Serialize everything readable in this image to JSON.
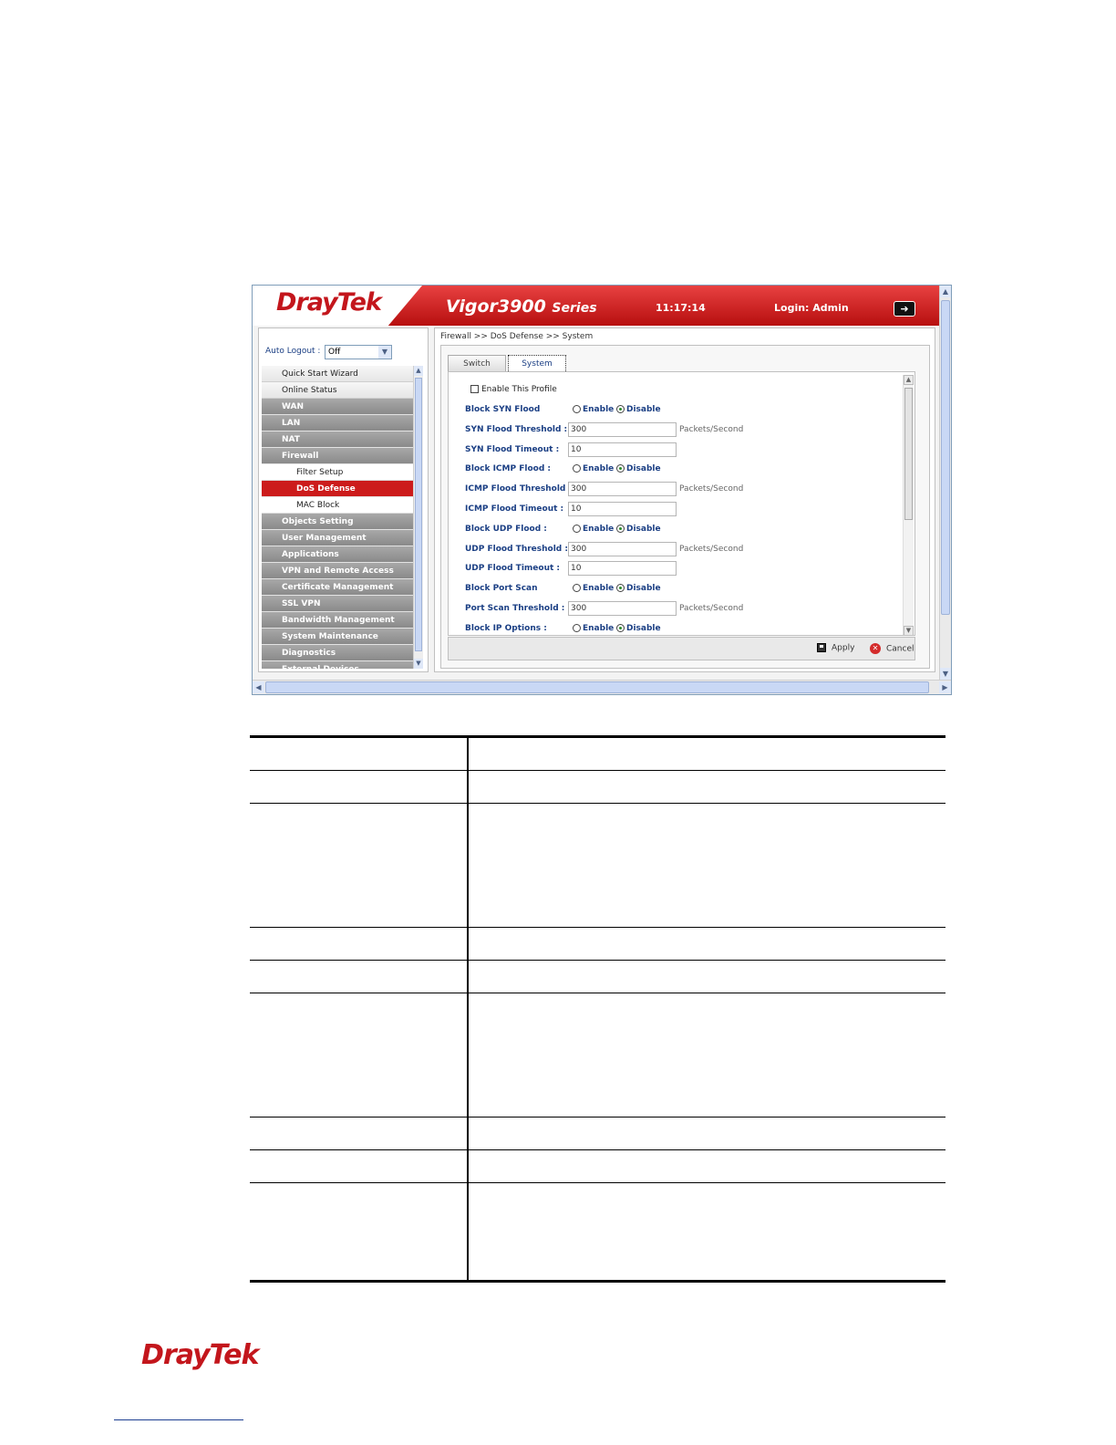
{
  "header": {
    "brand": "DrayTek",
    "model": "Vigor3900",
    "series": "Series",
    "time": "11:17:14",
    "login": "Login: Admin"
  },
  "left_panel": {
    "auto_logout_label": "Auto Logout :",
    "auto_logout_value": "Off",
    "menu": [
      {
        "label": "Quick Start Wizard",
        "style": "light"
      },
      {
        "label": "Online Status",
        "style": "light"
      },
      {
        "label": "WAN",
        "style": "dark"
      },
      {
        "label": "LAN",
        "style": "dark"
      },
      {
        "label": "NAT",
        "style": "dark"
      },
      {
        "label": "Firewall",
        "style": "dark"
      },
      {
        "label": "Filter Setup",
        "style": "sub"
      },
      {
        "label": "DoS Defense",
        "style": "active"
      },
      {
        "label": "MAC Block",
        "style": "sub"
      },
      {
        "label": "Objects Setting",
        "style": "dark"
      },
      {
        "label": "User Management",
        "style": "dark"
      },
      {
        "label": "Applications",
        "style": "dark"
      },
      {
        "label": "VPN and Remote Access",
        "style": "dark"
      },
      {
        "label": "Certificate Management",
        "style": "dark"
      },
      {
        "label": "SSL VPN",
        "style": "dark"
      },
      {
        "label": "Bandwidth Management",
        "style": "dark"
      },
      {
        "label": "System Maintenance",
        "style": "dark"
      },
      {
        "label": "Diagnostics",
        "style": "dark"
      },
      {
        "label": "External Devices",
        "style": "dark"
      }
    ]
  },
  "content": {
    "breadcrumb": "Firewall >> DoS Defense >> System",
    "tabs": [
      {
        "label": "Switch",
        "selected": false
      },
      {
        "label": "System",
        "selected": true
      }
    ],
    "enable_profile_label": "Enable This Profile",
    "enable_label": "Enable",
    "disable_label": "Disable",
    "unit_label": "Packets/Second",
    "rows": [
      {
        "type": "radio",
        "label": "Block SYN Flood",
        "value": "Disable"
      },
      {
        "type": "text",
        "label": "SYN Flood Threshold :",
        "value": "300",
        "unit": true
      },
      {
        "type": "text",
        "label": "SYN Flood Timeout :",
        "value": "10",
        "unit": false
      },
      {
        "type": "radio",
        "label": "Block ICMP Flood :",
        "value": "Disable"
      },
      {
        "type": "text",
        "label": "ICMP Flood Threshold :",
        "value": "300",
        "unit": true
      },
      {
        "type": "text",
        "label": "ICMP Flood Timeout :",
        "value": "10",
        "unit": false
      },
      {
        "type": "radio",
        "label": "Block UDP Flood :",
        "value": "Disable"
      },
      {
        "type": "text",
        "label": "UDP Flood Threshold :",
        "value": "300",
        "unit": true
      },
      {
        "type": "text",
        "label": "UDP Flood Timeout :",
        "value": "10",
        "unit": false
      },
      {
        "type": "radio",
        "label": "Block Port Scan",
        "value": "Disable"
      },
      {
        "type": "text",
        "label": "Port Scan Threshold :",
        "value": "300",
        "unit": true
      },
      {
        "type": "radio",
        "label": "Block IP Options :",
        "value": "Disable"
      }
    ],
    "apply_label": "Apply",
    "cancel_label": "Cancel"
  },
  "footer": {
    "brand": "DrayTek"
  }
}
